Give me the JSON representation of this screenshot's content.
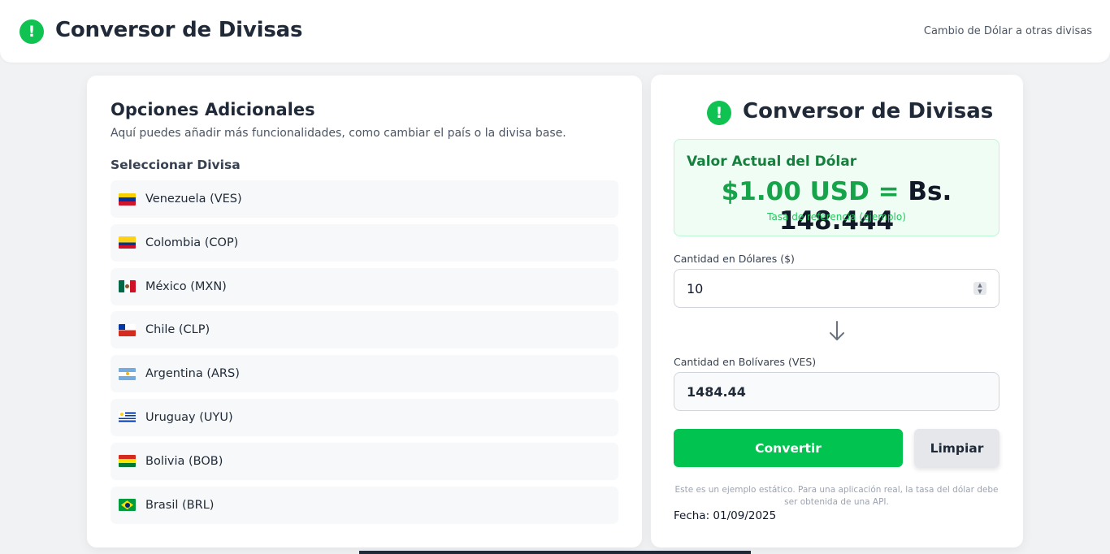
{
  "header": {
    "icon": "exclamation-circle-icon",
    "title": "Conversor de Divisas",
    "subtitle": "Cambio de Dólar a otras divisas"
  },
  "options": {
    "title": "Opciones Adicionales",
    "description": "Aquí puedes añadir más funcionalidades, como cambiar el país o la divisa base.",
    "select_label": "Seleccionar Divisa",
    "currencies": [
      {
        "flag": "venezuela-flag-icon",
        "label": "Venezuela (VES)"
      },
      {
        "flag": "colombia-flag-icon",
        "label": "Colombia (COP)"
      },
      {
        "flag": "mexico-flag-icon",
        "label": "México (MXN)"
      },
      {
        "flag": "chile-flag-icon",
        "label": "Chile (CLP)"
      },
      {
        "flag": "argentina-flag-icon",
        "label": "Argentina (ARS)"
      },
      {
        "flag": "uruguay-flag-icon",
        "label": "Uruguay (UYU)"
      },
      {
        "flag": "bolivia-flag-icon",
        "label": "Bolivia (BOB)"
      },
      {
        "flag": "brasil-flag-icon",
        "label": "Brasil (BRL)"
      }
    ]
  },
  "converter": {
    "icon": "exclamation-circle-icon",
    "title": "Conversor de Divisas",
    "rate": {
      "heading": "Valor Actual del Dólar",
      "usd": "$1.00 USD =",
      "ves": "Bs. 148.444",
      "note": "Tasa de referencia (ejemplo)"
    },
    "usd_label": "Cantidad en Dólares ($)",
    "usd_value": "10",
    "ves_label": "Cantidad en Bolívares (VES)",
    "ves_value": "1484.44",
    "convert_button": "Convertir",
    "clear_button": "Limpiar",
    "disclaimer": "Este es un ejemplo estático. Para una aplicación real, la tasa del dólar debe ser obtenida de una API.",
    "date": "Fecha: 01/09/2025"
  },
  "colors": {
    "accent": "#00c44f",
    "rate_green": "#16a34a",
    "background": "#f1f2f4"
  }
}
